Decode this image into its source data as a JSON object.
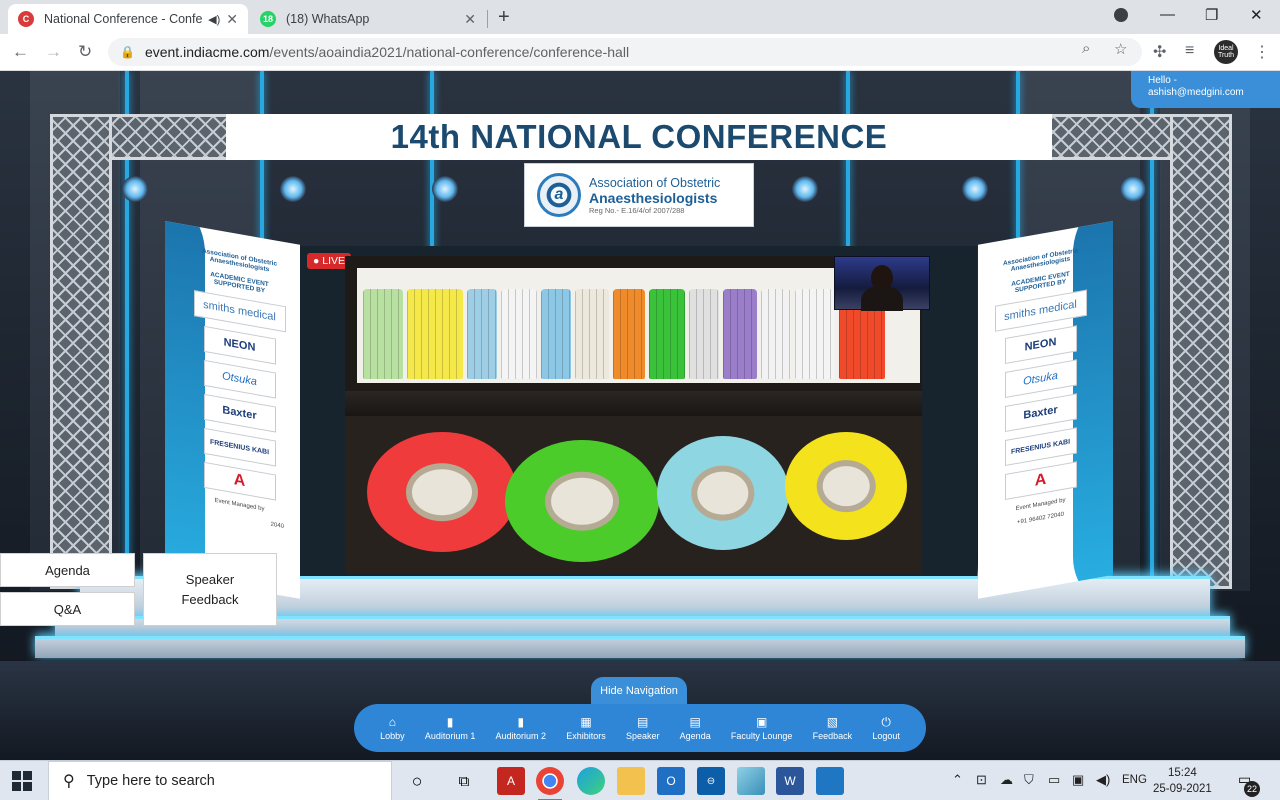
{
  "browser": {
    "tabs": [
      {
        "title": "National Conference - Confe",
        "active": true
      },
      {
        "title": "(18) WhatsApp",
        "active": false
      }
    ],
    "url_host": "event.indiacme.com",
    "url_path": "/events/aoaindia2021/national-conference/conference-hall",
    "whatsapp_badge": "18",
    "profile_text": "Ideal Truth"
  },
  "stage": {
    "banner_title": "14th NATIONAL CONFERENCE",
    "logo": {
      "seal_letter": "a",
      "line1": "Association of Obstetric",
      "line2": "Anaesthesiologists",
      "line3": "Reg No.- E.16/4/of 2007/288"
    },
    "sponsor_panel": {
      "heading_org": "Association of Obstetric Anaesthesiologists",
      "heading_event": "ACADEMIC EVENT SUPPORTED BY",
      "logos": [
        "smiths medical",
        "NEON",
        "Otsuka",
        "Baxter",
        "FRESENIUS KABI",
        "A"
      ],
      "managed_by": "Event Managed by",
      "phone": "+91 96402 72040",
      "phone_partial": "2040"
    },
    "live_label": "LIVE"
  },
  "user": {
    "greeting": "Hello -",
    "email": "ashish@medgini.com"
  },
  "side_buttons": {
    "agenda": "Agenda",
    "qa": "Q&A",
    "speaker_feedback": "Speaker Feedback"
  },
  "navigation": {
    "toggle_label": "Hide Navigation",
    "items": [
      {
        "label": "Lobby",
        "icon": "home-icon"
      },
      {
        "label": "Auditorium 1",
        "icon": "door-icon"
      },
      {
        "label": "Auditorium 2",
        "icon": "door-icon"
      },
      {
        "label": "Exhibitors",
        "icon": "grid-icon"
      },
      {
        "label": "Speaker",
        "icon": "document-icon"
      },
      {
        "label": "Agenda",
        "icon": "document-icon"
      },
      {
        "label": "Faculty Lounge",
        "icon": "presentation-icon"
      },
      {
        "label": "Feedback",
        "icon": "message-icon"
      },
      {
        "label": "Logout",
        "icon": "power-icon"
      }
    ]
  },
  "taskbar": {
    "search_placeholder": "Type here to search",
    "language": "ENG",
    "time": "15:24",
    "date": "25-09-2021",
    "notification_count": "22"
  },
  "colors": {
    "accent_blue": "#2f86d6",
    "banner_text": "#1c4a6e",
    "live_red": "#d62a2a"
  }
}
